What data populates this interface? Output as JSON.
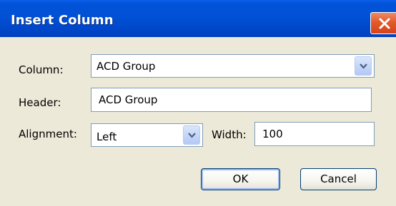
{
  "window": {
    "title": "Insert Column",
    "close_icon": "close-icon"
  },
  "form": {
    "column_label": "Column:",
    "column_value": "ACD Group",
    "header_label": "Header:",
    "header_value": "ACD Group",
    "alignment_label": "Alignment:",
    "alignment_value": "Left",
    "width_label": "Width:",
    "width_value": "100"
  },
  "buttons": {
    "ok_label": "OK",
    "cancel_label": "Cancel"
  },
  "colors": {
    "titlebar": "#0151d6",
    "close_button": "#e35a2c",
    "dialog_background": "#ece9d8",
    "field_border": "#7f9db9"
  }
}
